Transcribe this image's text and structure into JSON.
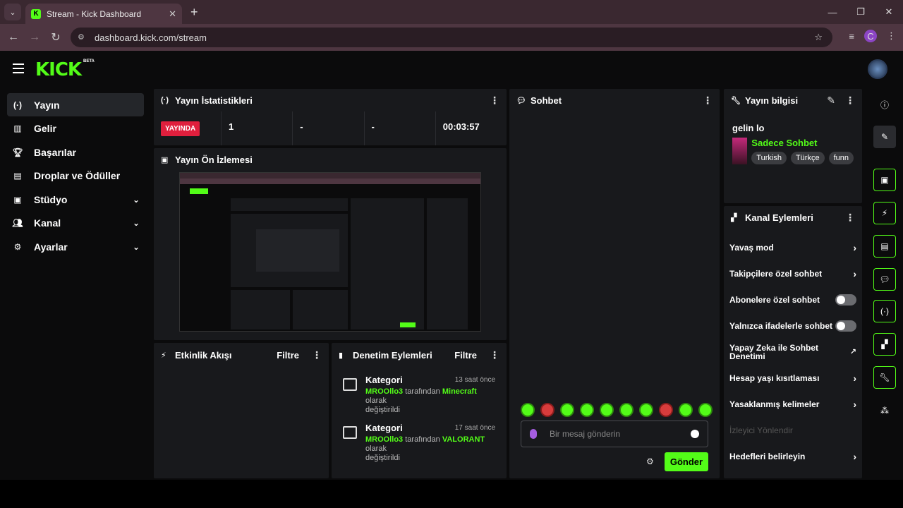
{
  "browser": {
    "tab_title": "Stream - Kick Dashboard",
    "url": "dashboard.kick.com/stream",
    "profile_initial": "C"
  },
  "brand": {
    "logo": "KICK",
    "beta": "BETA"
  },
  "sidebar": {
    "items": [
      {
        "label": "Yayın",
        "icon": "broadcast-icon"
      },
      {
        "label": "Gelir",
        "icon": "chart-icon"
      },
      {
        "label": "Başarılar",
        "icon": "trophy-icon"
      },
      {
        "label": "Droplar ve Ödüller",
        "icon": "gift-icon"
      },
      {
        "label": "Stüdyo",
        "icon": "studio-icon"
      },
      {
        "label": "Kanal",
        "icon": "users-icon"
      },
      {
        "label": "Ayarlar",
        "icon": "gear-icon"
      }
    ]
  },
  "stats_panel": {
    "title": "Yayın İstatistikleri",
    "live": "YAYINDA",
    "viewers": "1",
    "followers": "-",
    "subs": "-",
    "time": "00:03:57"
  },
  "preview_panel": {
    "title": "Yayın Ön İzlemesi"
  },
  "activity_panel": {
    "title": "Etkinlik Akışı",
    "filter": "Filtre"
  },
  "mod_panel": {
    "title": "Denetim Eylemleri",
    "filter": "Filtre",
    "items": [
      {
        "title": "Kategori",
        "time": "13 saat önce",
        "user": "MROOllo3",
        "mid": "tarafından",
        "game": "Minecraft",
        "tail": "olarak",
        "end": "değiştirildi"
      },
      {
        "title": "Kategori",
        "time": "17 saat önce",
        "user": "MROOllo3",
        "mid": "tarafından",
        "game": "VALORANT",
        "tail": "olarak",
        "end": "değiştirildi"
      }
    ]
  },
  "chat_panel": {
    "title": "Sohbet",
    "placeholder": "Bir mesaj gönderin",
    "send": "Gönder"
  },
  "stream_info": {
    "title": "Yayın bilgisi",
    "stream_title": "gelin lo",
    "category": "Sadece Sohbet",
    "tags": [
      "Turkish",
      "Türkçe",
      "funn"
    ]
  },
  "channel_actions": {
    "title": "Kanal Eylemleri",
    "items": [
      {
        "label": "Yavaş mod",
        "type": "arrow"
      },
      {
        "label": "Takipçilere özel sohbet",
        "type": "arrow"
      },
      {
        "label": "Abonelere özel sohbet",
        "type": "toggle"
      },
      {
        "label": "Yalnızca ifadelerle sohbet",
        "type": "toggle"
      },
      {
        "label": "Yapay Zeka ile Sohbet Denetimi",
        "type": "external"
      },
      {
        "label": "Hesap yaşı kısıtlaması",
        "type": "arrow"
      },
      {
        "label": "Yasaklanmış kelimeler",
        "type": "arrow"
      },
      {
        "label": "İzleyici Yönlendir",
        "type": "none"
      },
      {
        "label": "Hedefleri belirleyin",
        "type": "arrow"
      }
    ]
  }
}
